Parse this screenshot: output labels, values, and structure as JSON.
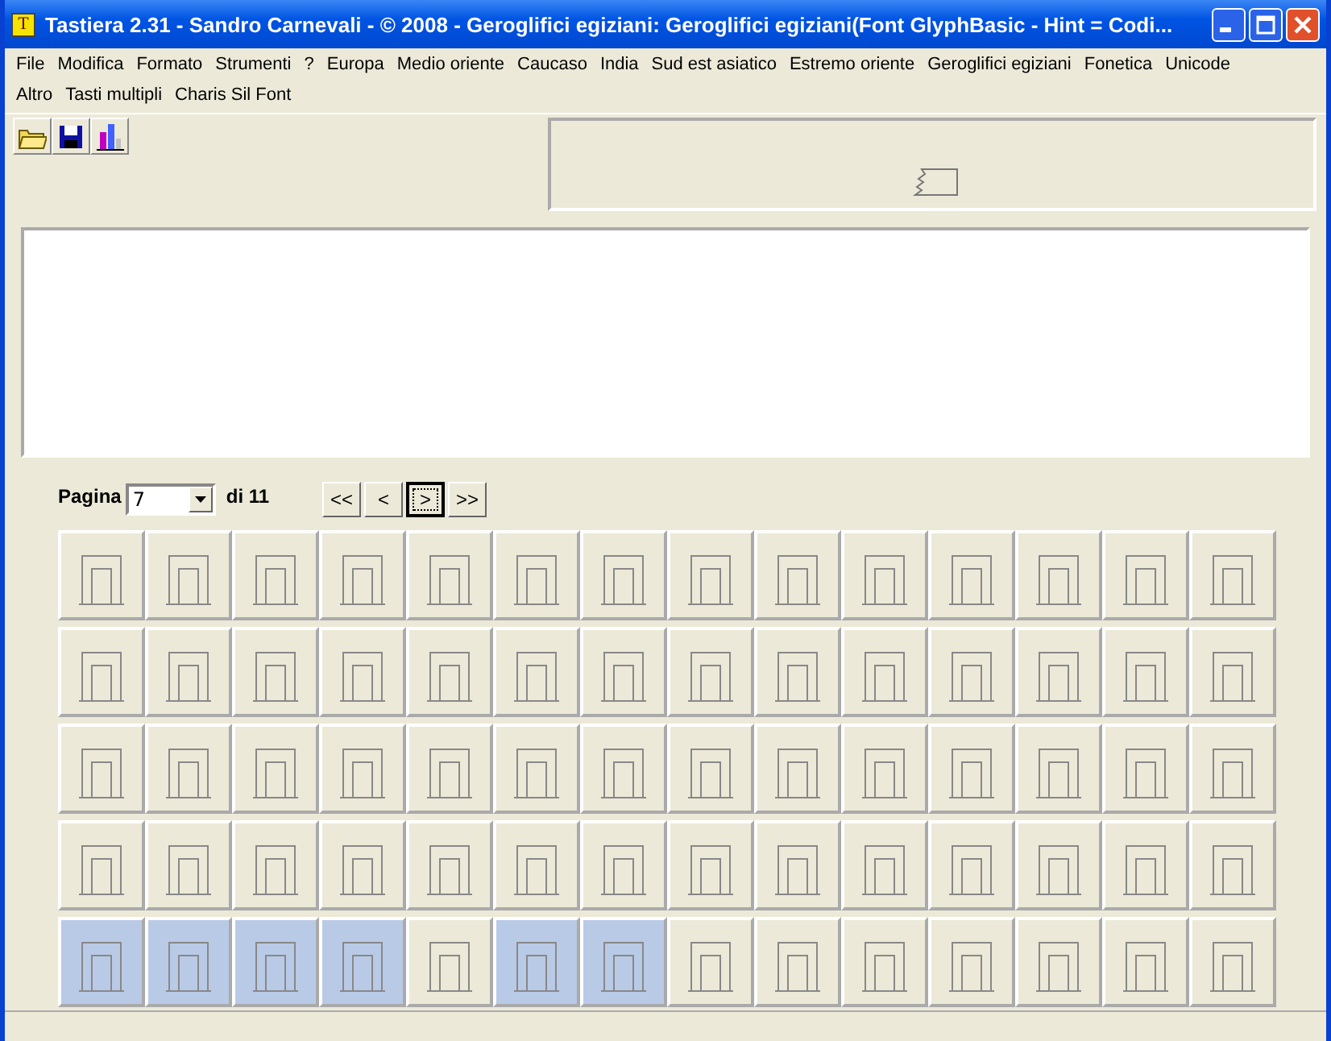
{
  "window": {
    "title": "Tastiera 2.31 - Sandro Carnevali - ©  2008 - Geroglifici egiziani: Geroglifici egiziani(Font GlyphBasic - Hint = Codi...",
    "icon_letter": "T"
  },
  "menu": [
    "File",
    "Modifica",
    "Formato",
    "Strumenti",
    "?",
    "Europa",
    "Medio oriente",
    "Caucaso",
    "India",
    "Sud est asiatico",
    "Estremo oriente",
    "Geroglifici egiziani",
    "Fonetica",
    "Unicode",
    "Altro",
    "Tasti multipli",
    "Charis Sil Font"
  ],
  "pager": {
    "label": "Pagina",
    "page": "7",
    "of_label": "di 11",
    "nav": [
      {
        "label": "<<",
        "selected": false
      },
      {
        "label": "<",
        "selected": false
      },
      {
        "label": ">",
        "selected": true
      },
      {
        "label": ">>",
        "selected": false
      }
    ]
  },
  "glyph_rows": [
    [
      false,
      false,
      false,
      false,
      false,
      false,
      false,
      false,
      false,
      false,
      false,
      false,
      false,
      false
    ],
    [
      false,
      false,
      false,
      false,
      false,
      false,
      false,
      false,
      false,
      false,
      false,
      false,
      false,
      false
    ],
    [
      false,
      false,
      false,
      false,
      false,
      false,
      false,
      false,
      false,
      false,
      false,
      false,
      false,
      false
    ],
    [
      false,
      false,
      false,
      false,
      false,
      false,
      false,
      false,
      false,
      false,
      false,
      false,
      false,
      false
    ],
    [
      true,
      true,
      true,
      true,
      false,
      true,
      true,
      false,
      false,
      false,
      false,
      false,
      false,
      false
    ]
  ]
}
